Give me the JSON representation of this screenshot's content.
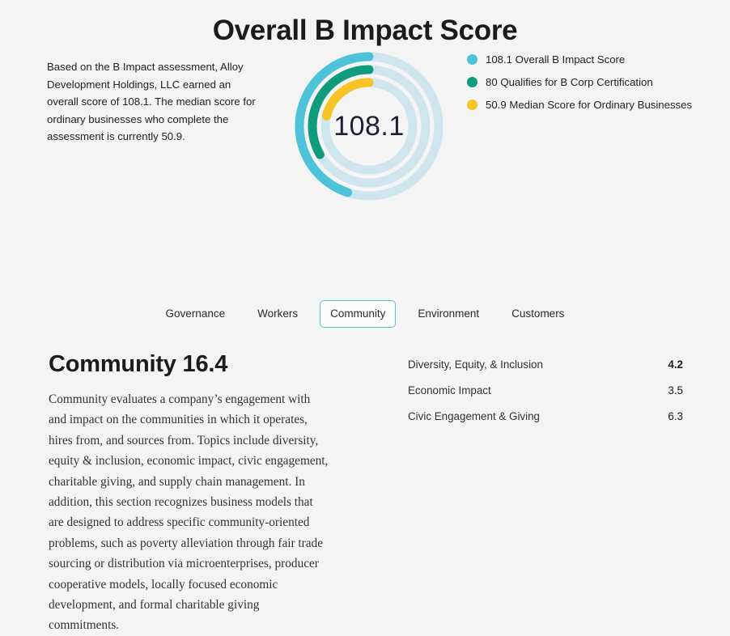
{
  "page": {
    "title": "Overall B Impact Score",
    "background_color": "#f4f4f4"
  },
  "intro": {
    "text": "Based on the B Impact assessment, Alloy Development Holdings, LLC earned an overall score of 108.1. The median score for ordinary businesses who complete the assessment is currently 50.9."
  },
  "chart_data": {
    "type": "pie",
    "title": "Overall B Impact Score",
    "center_value": "108.1",
    "max_scale": 120,
    "sweep_degrees": 180,
    "grid": false,
    "legend_position": "right",
    "track_color": "#cfe6ef",
    "series": [
      {
        "name": "Overall B Impact Score",
        "value": 108.1,
        "color": "#4cc3d9",
        "ring": "outer",
        "radius": 86,
        "legend_text": "108.1 Overall B Impact Score"
      },
      {
        "name": "Qualifies for B Corp Certification",
        "value": 80,
        "color": "#0f9b7e",
        "ring": "middle",
        "radius": 70,
        "legend_text": "80 Qualifies for B Corp Certification"
      },
      {
        "name": "Median Score for Ordinary Businesses",
        "value": 50.9,
        "color": "#f6c425",
        "ring": "inner",
        "radius": 54,
        "legend_text": "50.9 Median Score for Ordinary Businesses"
      }
    ]
  },
  "legend": {
    "items": [
      {
        "label": "108.1 Overall B Impact Score",
        "color": "#4cc3d9"
      },
      {
        "label": "80 Qualifies for B Corp Certification",
        "color": "#0f9b7e"
      },
      {
        "label": "50.9 Median Score for Ordinary Businesses",
        "color": "#f6c425"
      }
    ]
  },
  "tabs": {
    "active_index": 2,
    "items": [
      {
        "label": "Governance"
      },
      {
        "label": "Workers"
      },
      {
        "label": "Community"
      },
      {
        "label": "Environment"
      },
      {
        "label": "Customers"
      }
    ]
  },
  "section": {
    "title": "Community 16.4",
    "body": "Community evaluates a company’s engagement with and impact on the communities in which it operates, hires from, and sources from. Topics include diversity, equity & inclusion, economic impact, civic engagement, charitable giving, and supply chain management. In addition, this section recognizes business models that are designed to address specific community-oriented problems, such as poverty alleviation through fair trade sourcing or distribution via microenterprises, producer cooperative models, locally focused economic development, and formal charitable giving commitments."
  },
  "scores": {
    "rows": [
      {
        "name": "Diversity, Equity, & Inclusion",
        "value": "4.2",
        "bold": true
      },
      {
        "name": "Economic Impact",
        "value": "3.5",
        "bold": false
      },
      {
        "name": "Civic Engagement & Giving",
        "value": "6.3",
        "bold": false
      }
    ]
  }
}
